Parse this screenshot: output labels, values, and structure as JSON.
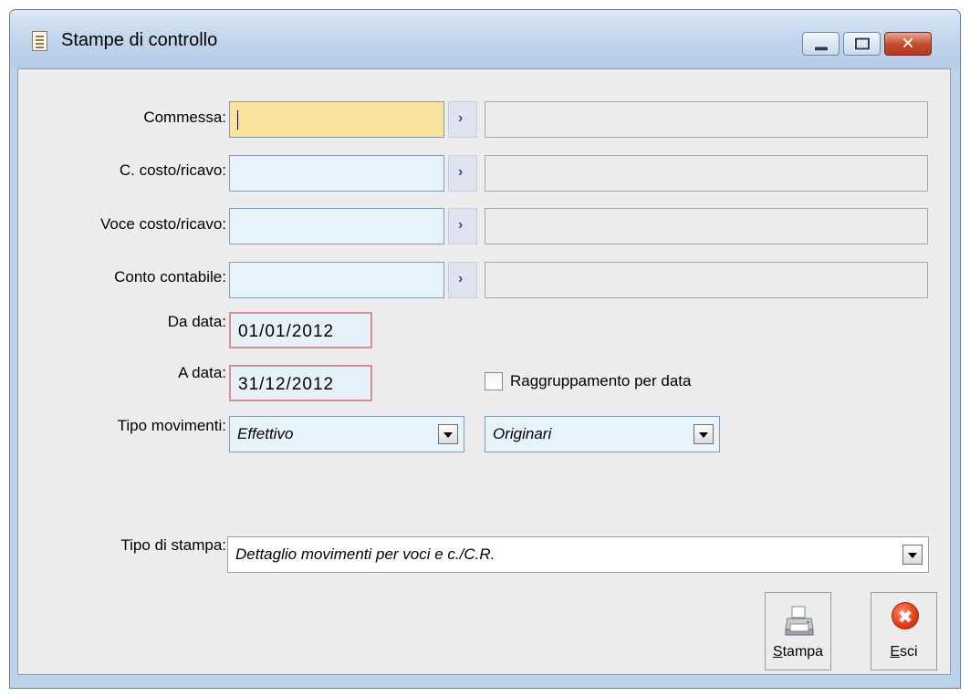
{
  "window": {
    "title": "Stampe di controllo",
    "icons": {
      "app": "document-icon",
      "minimize": "minimize-icon",
      "maximize": "maximize-icon",
      "close": "close-icon"
    },
    "close_glyph": "✕"
  },
  "form": {
    "commessa_label": "Commessa:",
    "costo_ricavo_label": "C. costo/ricavo:",
    "voce_label": "Voce costo/ricavo:",
    "conto_label": "Conto contabile:",
    "zoom_glyph": "›",
    "da_data_label": "Da data:",
    "da_data_value": "01/01/2012",
    "a_data_label": "A data:",
    "a_data_value": "31/12/2012",
    "raggruppamento_label": "Raggruppamento per data",
    "tipo_movimenti_label": "Tipo movimenti:",
    "tipo_movimenti_value": "Effettivo",
    "origine_value": "Originari",
    "tipo_stampa_label": "Tipo di stampa:",
    "tipo_stampa_value": "Dettaglio movimenti per voci e c./C.R."
  },
  "buttons": {
    "stampa_mnemonic": "S",
    "stampa_rest": "tampa",
    "esci_mnemonic": "E",
    "esci_rest": "sci",
    "esci_glyph": "✖"
  },
  "colors": {
    "mandatory_field": "#fbe39e",
    "input_field": "#e6f3fb",
    "date_border": "#d78d95",
    "window_frame": "#bcd3ea"
  }
}
